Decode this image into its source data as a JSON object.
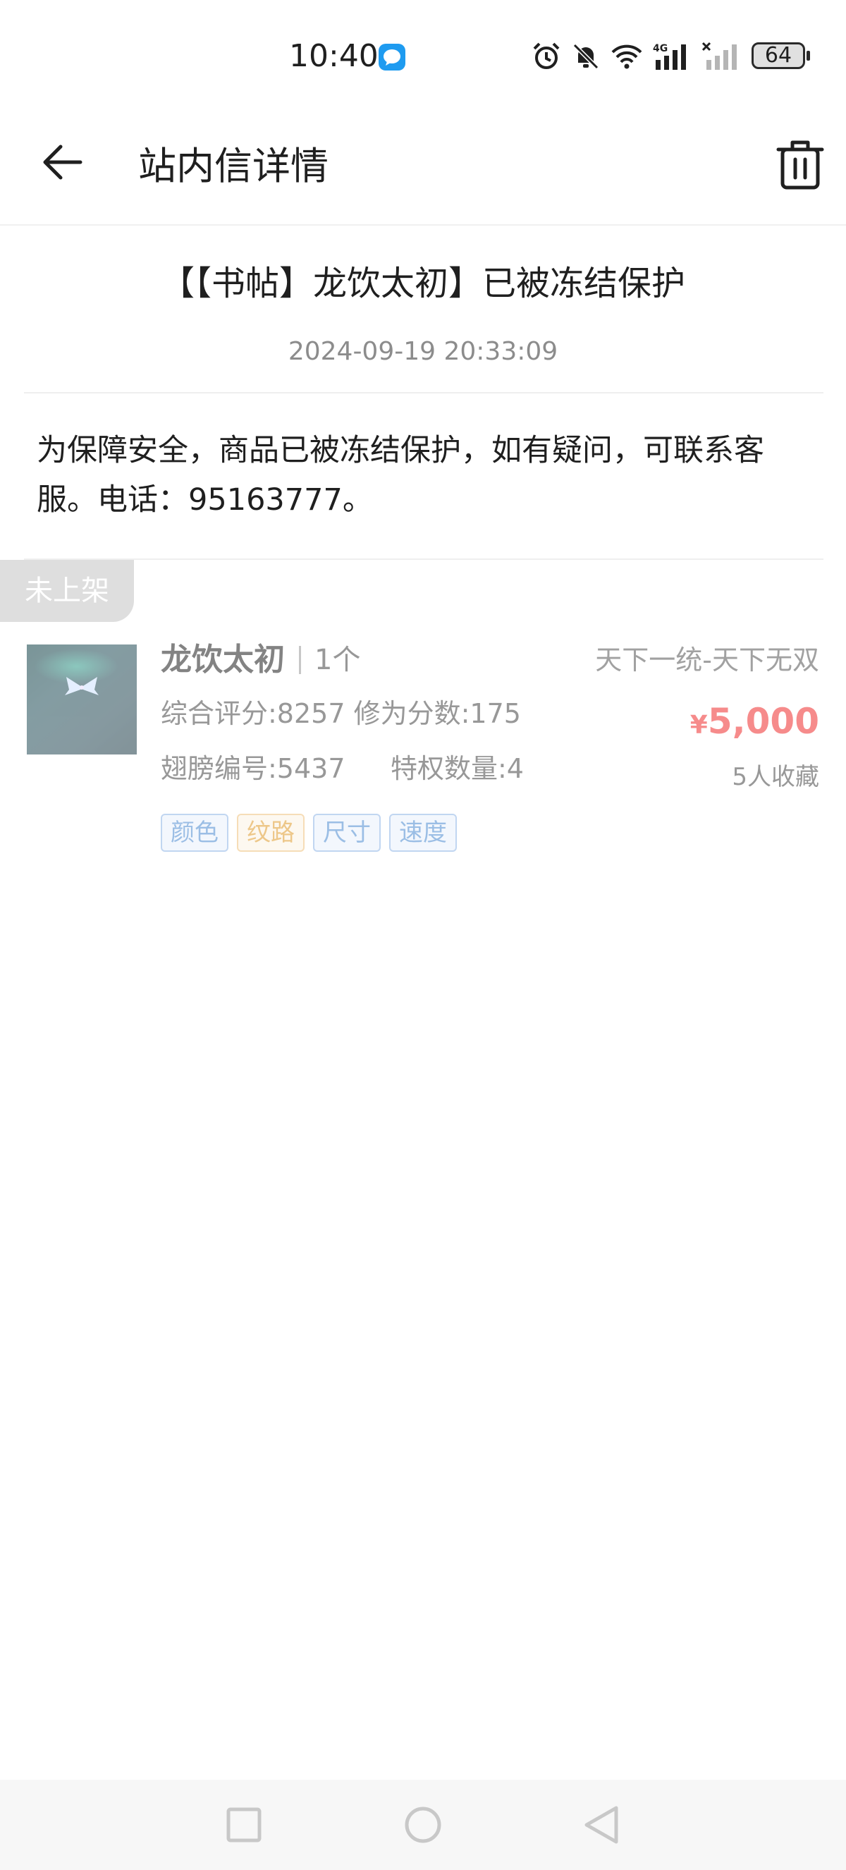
{
  "status_bar": {
    "time": "10:40",
    "battery": "64",
    "icons": [
      "chat-notification-icon",
      "alarm-icon",
      "bell-off-icon",
      "wifi-icon",
      "signal-4g-icon",
      "signal-no-service-icon",
      "battery-icon"
    ]
  },
  "app_bar": {
    "title": "站内信详情",
    "back_icon": "back-arrow-icon",
    "delete_icon": "trash-icon"
  },
  "message": {
    "title": "【【书帖】龙饮太初】已被冻结保护",
    "date": "2024-09-19 20:33:09",
    "body": "为保障安全，商品已被冻结保护，如有疑问，可联系客服。电话：95163777。"
  },
  "item": {
    "status_tag": "未上架",
    "name": "龙饮太初",
    "qty": "1个",
    "server": "天下一统-天下无双",
    "stat_score": "综合评分:8257 修为分数:175",
    "stat_wing": "翅膀编号:5437",
    "stat_privilege": "特权数量:4",
    "price_symbol": "¥",
    "price": "5,000",
    "favorites": "5人收藏",
    "tags": [
      "颜色",
      "纹路",
      "尺寸",
      "速度"
    ]
  },
  "nav_bar": {
    "icons": [
      "recent-apps-icon",
      "home-icon",
      "back-icon"
    ]
  }
}
